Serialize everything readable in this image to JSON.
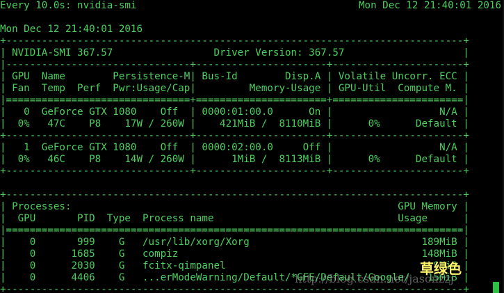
{
  "watch": {
    "command": "Every 10.0s: nvidia-smi",
    "time": "Mon Dec 12 21:40:01 2016"
  },
  "output_lines": [
    "Mon Dec 12 21:40:01 2016",
    "+-----------------------------------------------------------------------------+",
    "| NVIDIA-SMI 367.57                 Driver Version: 367.57                    |",
    "|-------------------------------+----------------------+----------------------+",
    "| GPU  Name        Persistence-M| Bus-Id        Disp.A | Volatile Uncorr. ECC |",
    "| Fan  Temp  Perf  Pwr:Usage/Cap|         Memory-Usage | GPU-Util  Compute M. |",
    "|===============================+======================+======================|",
    "|   0  GeForce GTX 1080    Off  | 0000:01:00.0      On |                  N/A |",
    "|  0%   47C    P8    17W / 260W |    421MiB /  8110MiB |      0%      Default |",
    "+-------------------------------+----------------------+----------------------+",
    "|   1  GeForce GTX 1080    Off  | 0000:02:00.0     Off |                  N/A |",
    "|  0%   46C    P8    14W / 260W |      1MiB /  8113MiB |      0%      Default |",
    "+-------------------------------+----------------------+----------------------+",
    "",
    "+-----------------------------------------------------------------------------+",
    "| Processes:                                                       GPU Memory |",
    "|  GPU       PID  Type  Process name                               Usage      |",
    "|=============================================================================|",
    "|    0       999    G   /usr/lib/xorg/Xorg                             189MiB |",
    "|    0      1685    G   compiz                                         148MiB |",
    "|    0      2030    G   fcitx-qimpanel                                   9MiB |",
    "|    0      4406    G   ...erModeWarning/Default/*GFE/Default/Google/   15MiB |",
    "+-----------------------------------------------------------------------------+"
  ],
  "watermark": "http://blog.csdn.net/jasonzzj",
  "brand": "草绿色",
  "colors": {
    "background": "#000000",
    "text": "#4bd05e",
    "cursor": "#2ec045",
    "brand": "#fff36b"
  }
}
